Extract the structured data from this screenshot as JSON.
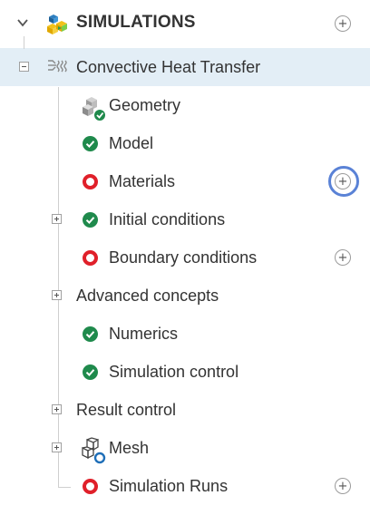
{
  "header": {
    "title": "SIMULATIONS",
    "chevron_icon": "chevron-down-icon",
    "logo_icon": "simscale-logo-icon",
    "add_label": "+"
  },
  "simulation": {
    "name": "Convective Heat Transfer",
    "icon": "convective-heat-transfer-icon",
    "expanded": true,
    "selected": true
  },
  "tree": {
    "items": [
      {
        "label": "Geometry",
        "status": "geometry-ok-icon"
      },
      {
        "label": "Model",
        "status": "ok"
      },
      {
        "label": "Materials",
        "status": "error",
        "add": "+"
      },
      {
        "label": "Initial conditions",
        "status": "ok",
        "expandable": true
      },
      {
        "label": "Boundary conditions",
        "status": "error",
        "add": "+"
      },
      {
        "label": "Advanced concepts",
        "expandable": true
      },
      {
        "label": "Numerics",
        "status": "ok"
      },
      {
        "label": "Simulation control",
        "status": "ok"
      },
      {
        "label": "Result control",
        "expandable": true
      },
      {
        "label": "Mesh",
        "status": "mesh-pending-icon",
        "expandable": true
      },
      {
        "label": "Simulation Runs",
        "status": "error",
        "add": "+"
      }
    ]
  },
  "colors": {
    "selected_bg": "#e3eef6",
    "ok_green": "#1f8a4c",
    "error_red": "#e0202a",
    "highlight_ring": "#5a82d6"
  }
}
